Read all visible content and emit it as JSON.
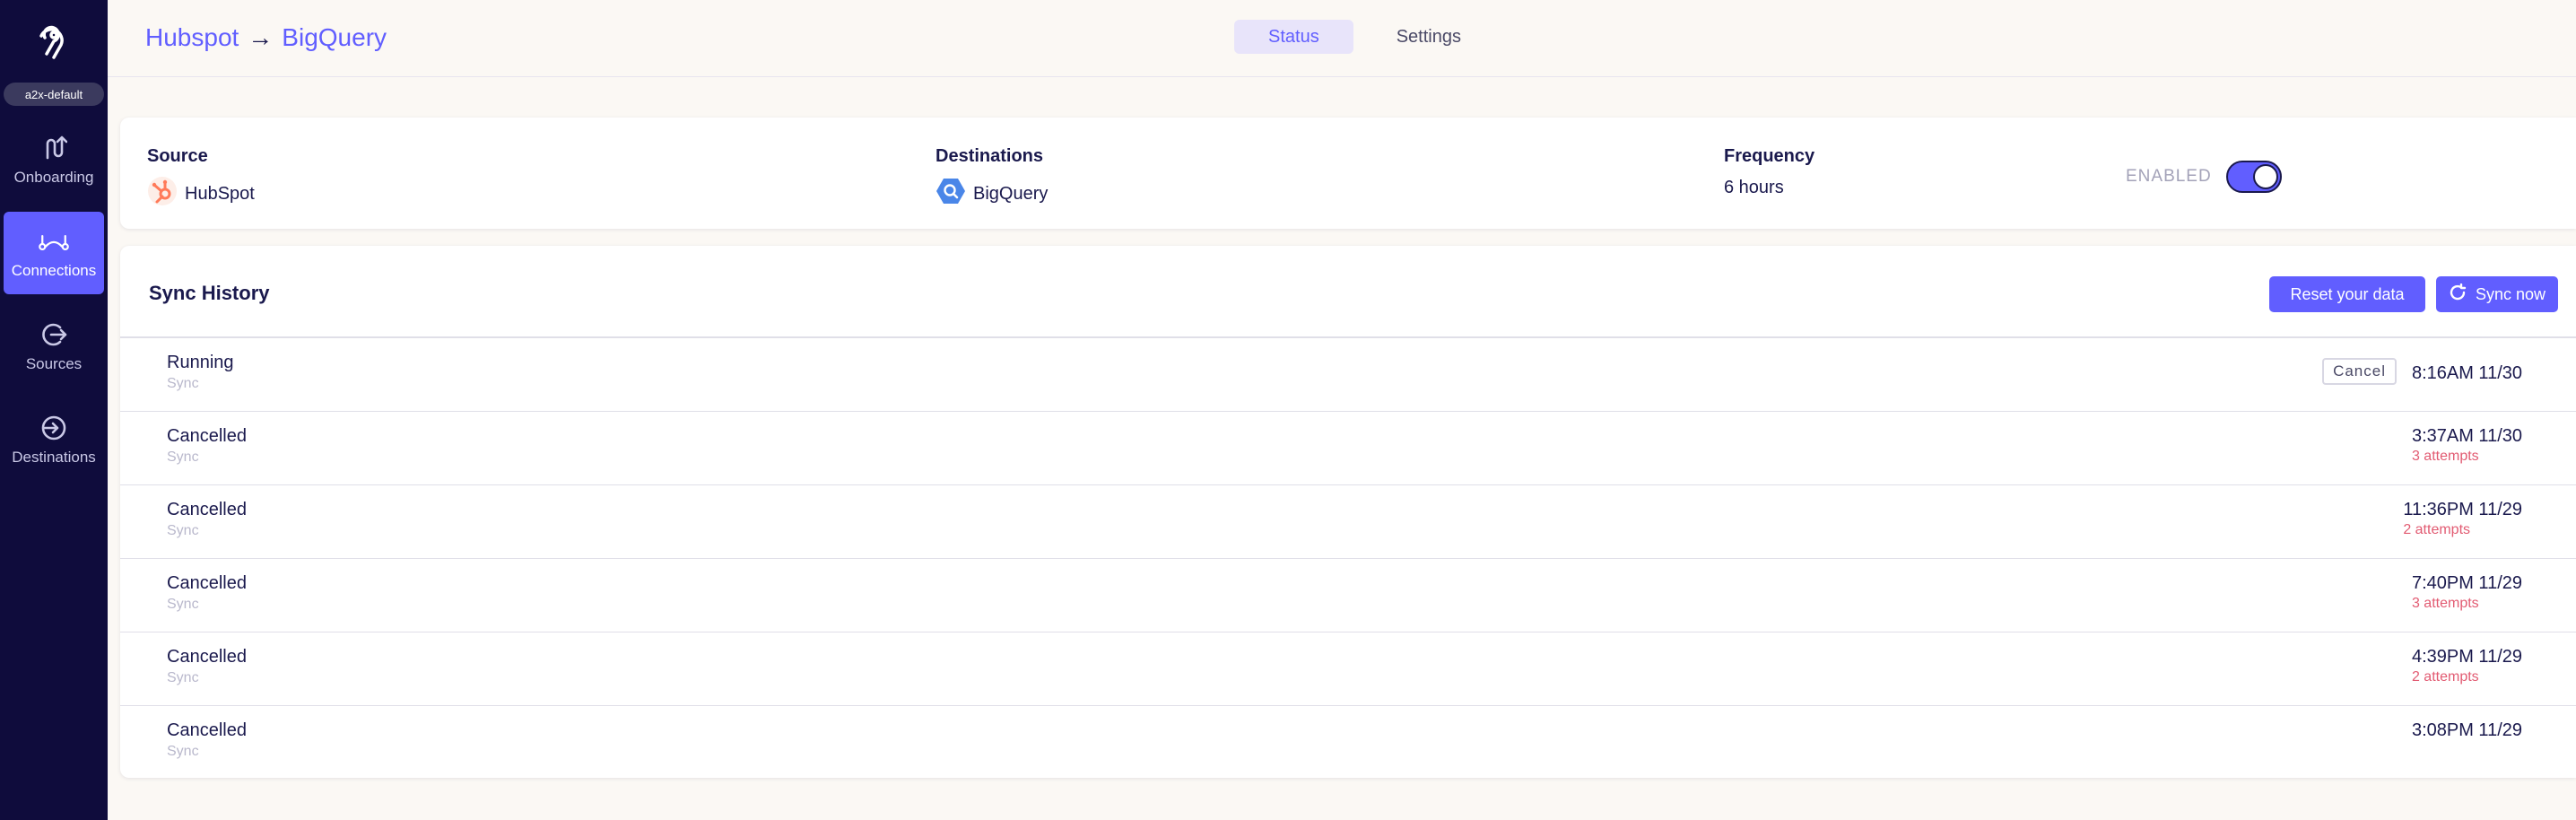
{
  "sidebar": {
    "workspace": "a2x-default",
    "items": [
      {
        "label": "Onboarding",
        "icon": "onboarding-icon",
        "active": false
      },
      {
        "label": "Connections",
        "icon": "connections-icon",
        "active": true
      },
      {
        "label": "Sources",
        "icon": "sources-icon",
        "active": false
      },
      {
        "label": "Destinations",
        "icon": "destinations-icon",
        "active": false
      }
    ]
  },
  "header": {
    "source_name": "Hubspot",
    "arrow": "→",
    "destination_name": "BigQuery",
    "tabs": [
      {
        "label": "Status",
        "active": true
      },
      {
        "label": "Settings",
        "active": false
      }
    ]
  },
  "connection": {
    "source_label": "Source",
    "source_value": "HubSpot",
    "destinations_label": "Destinations",
    "destination_value": "BigQuery",
    "frequency_label": "Frequency",
    "frequency_value": "6 hours",
    "enabled_label": "ENABLED",
    "enabled": true
  },
  "sync_history": {
    "title": "Sync History",
    "reset_label": "Reset your data",
    "sync_now_label": "Sync now",
    "rows": [
      {
        "status": "Running",
        "type": "Sync",
        "time": "8:16AM 11/30",
        "attempts": "",
        "cancel_label": "Cancel"
      },
      {
        "status": "Cancelled",
        "type": "Sync",
        "time": "3:37AM 11/30",
        "attempts": "3 attempts"
      },
      {
        "status": "Cancelled",
        "type": "Sync",
        "time": "11:36PM 11/29",
        "attempts": "2 attempts"
      },
      {
        "status": "Cancelled",
        "type": "Sync",
        "time": "7:40PM 11/29",
        "attempts": "3 attempts"
      },
      {
        "status": "Cancelled",
        "type": "Sync",
        "time": "4:39PM 11/29",
        "attempts": "2 attempts"
      },
      {
        "status": "Cancelled",
        "type": "Sync",
        "time": "3:08PM 11/29",
        "attempts": ""
      }
    ]
  },
  "colors": {
    "accent": "#615eff",
    "sidebar_bg": "#0f0c3c",
    "error": "#e25b72",
    "page_bg": "#fbf8f4"
  }
}
